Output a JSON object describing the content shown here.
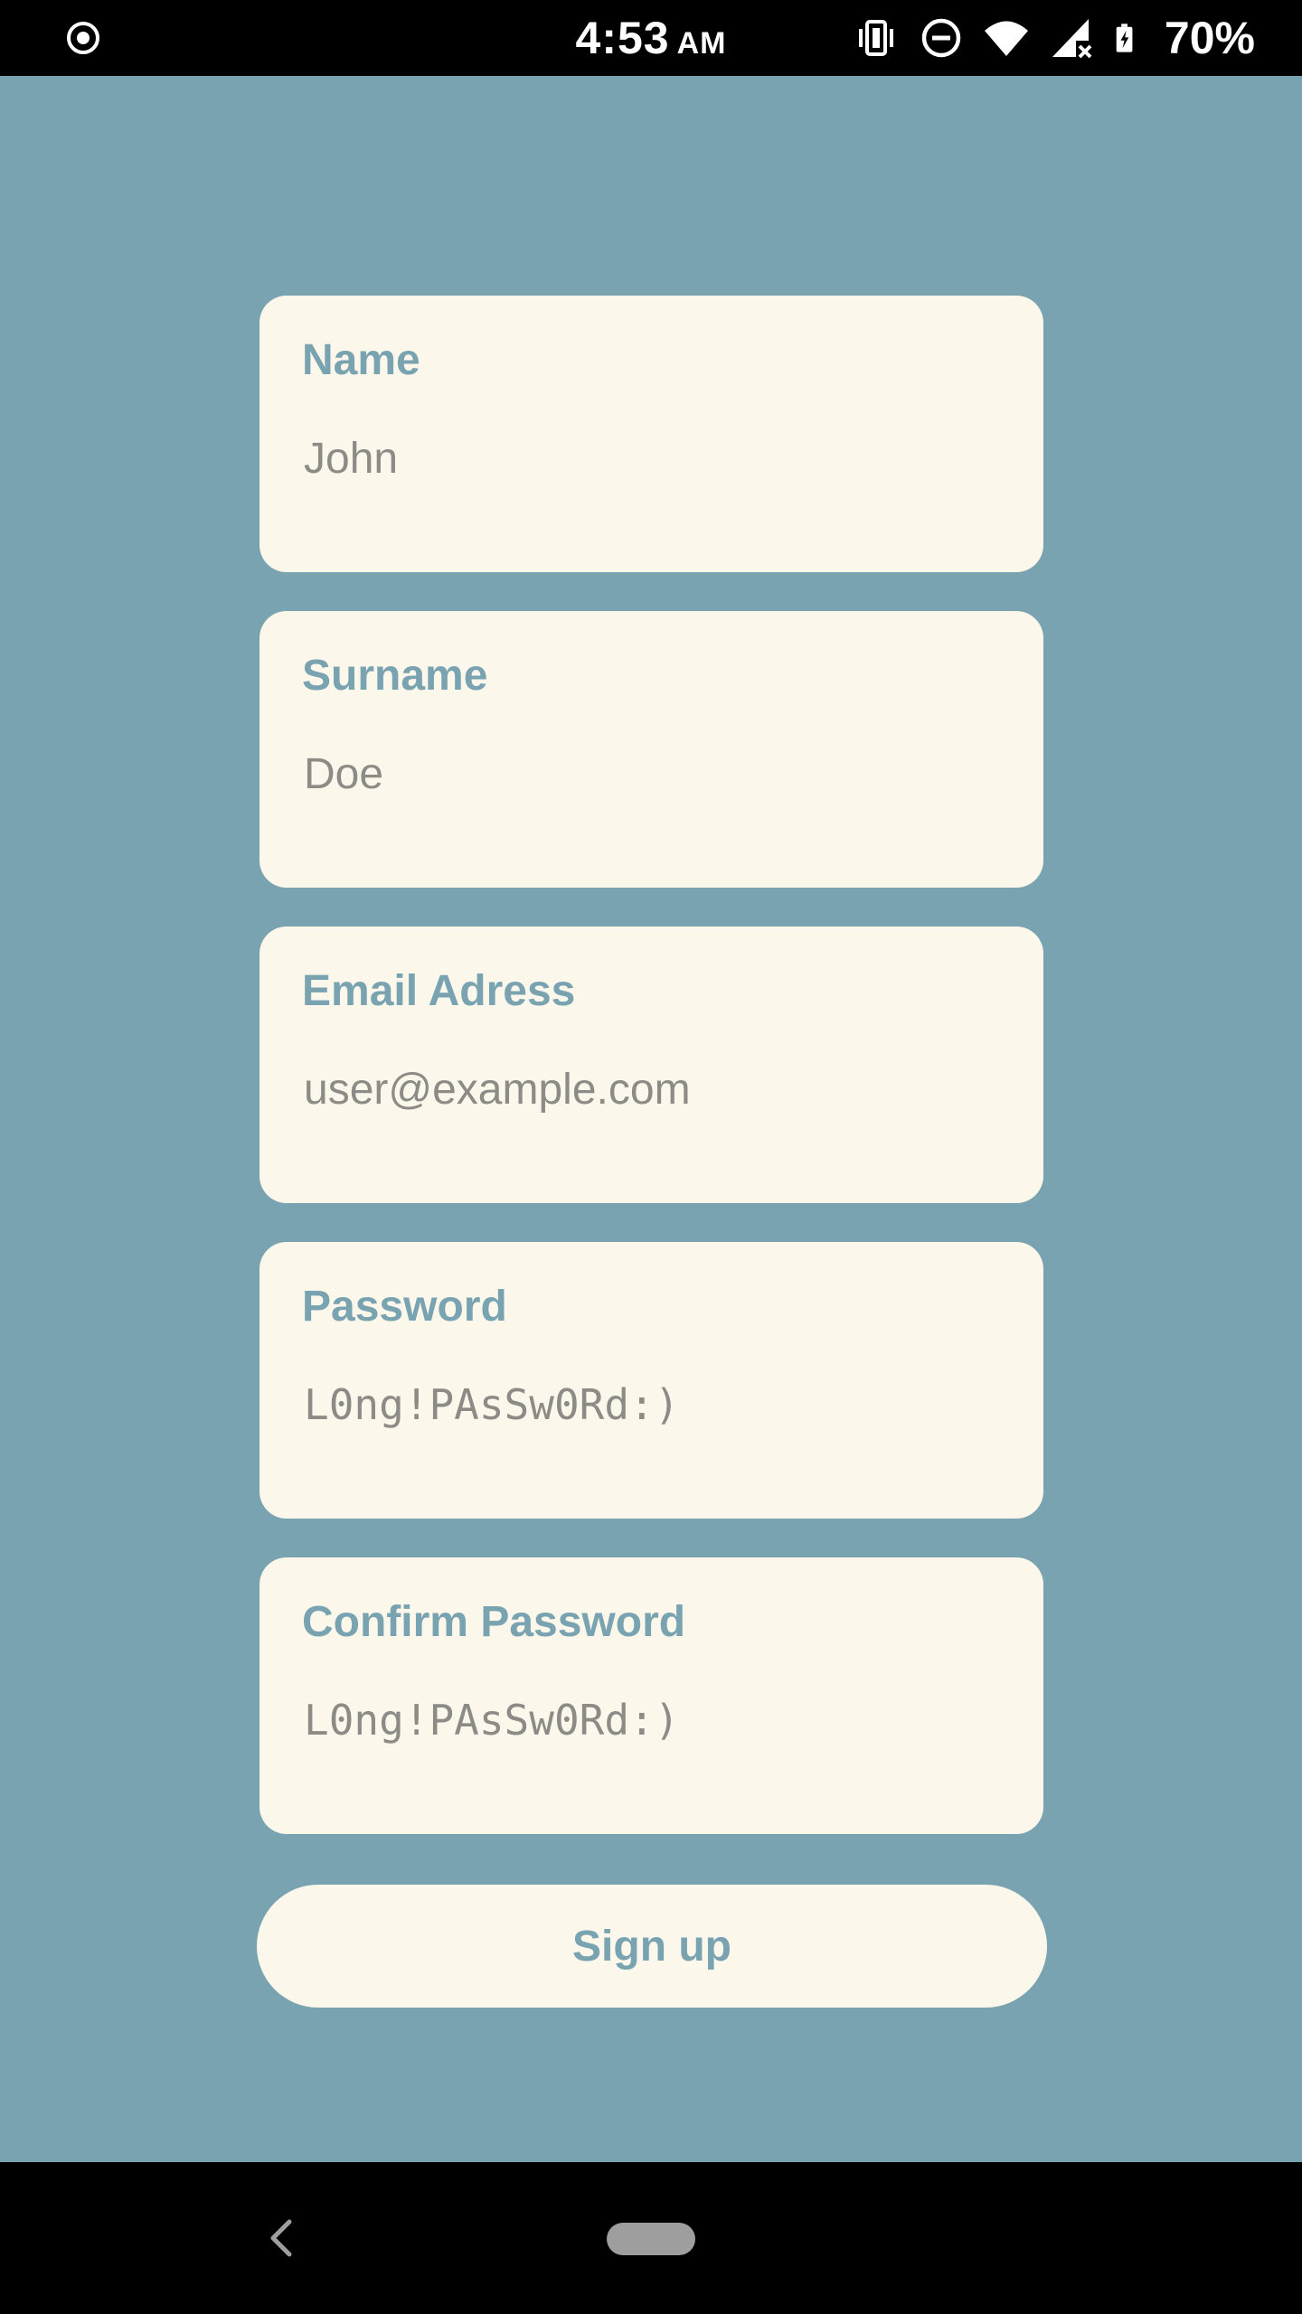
{
  "status_bar": {
    "time": "4:53",
    "ampm": "AM",
    "battery_percent": "70%",
    "icons": [
      "record-icon",
      "vibrate-icon",
      "do-not-disturb-icon",
      "wifi-icon",
      "signal-icon",
      "battery-charging-icon"
    ]
  },
  "form": {
    "fields": [
      {
        "label": "Name",
        "value": "John"
      },
      {
        "label": "Surname",
        "value": "Doe"
      },
      {
        "label": "Email Adress",
        "value": "user@example.com"
      },
      {
        "label": "Password",
        "value": "L0ng!PAsSw0Rd:)"
      },
      {
        "label": "Confirm Password",
        "value": "L0ng!PAsSw0Rd:)"
      }
    ],
    "submit_label": "Sign up"
  },
  "nav_bar": {
    "icons": [
      "back-icon",
      "home-pill-icon"
    ]
  },
  "colors": {
    "background": "#7aa3b1",
    "card": "#fbf7eb",
    "accent": "#7aa3b1",
    "input_text": "#8d8b86",
    "system_bar": "#000000"
  }
}
